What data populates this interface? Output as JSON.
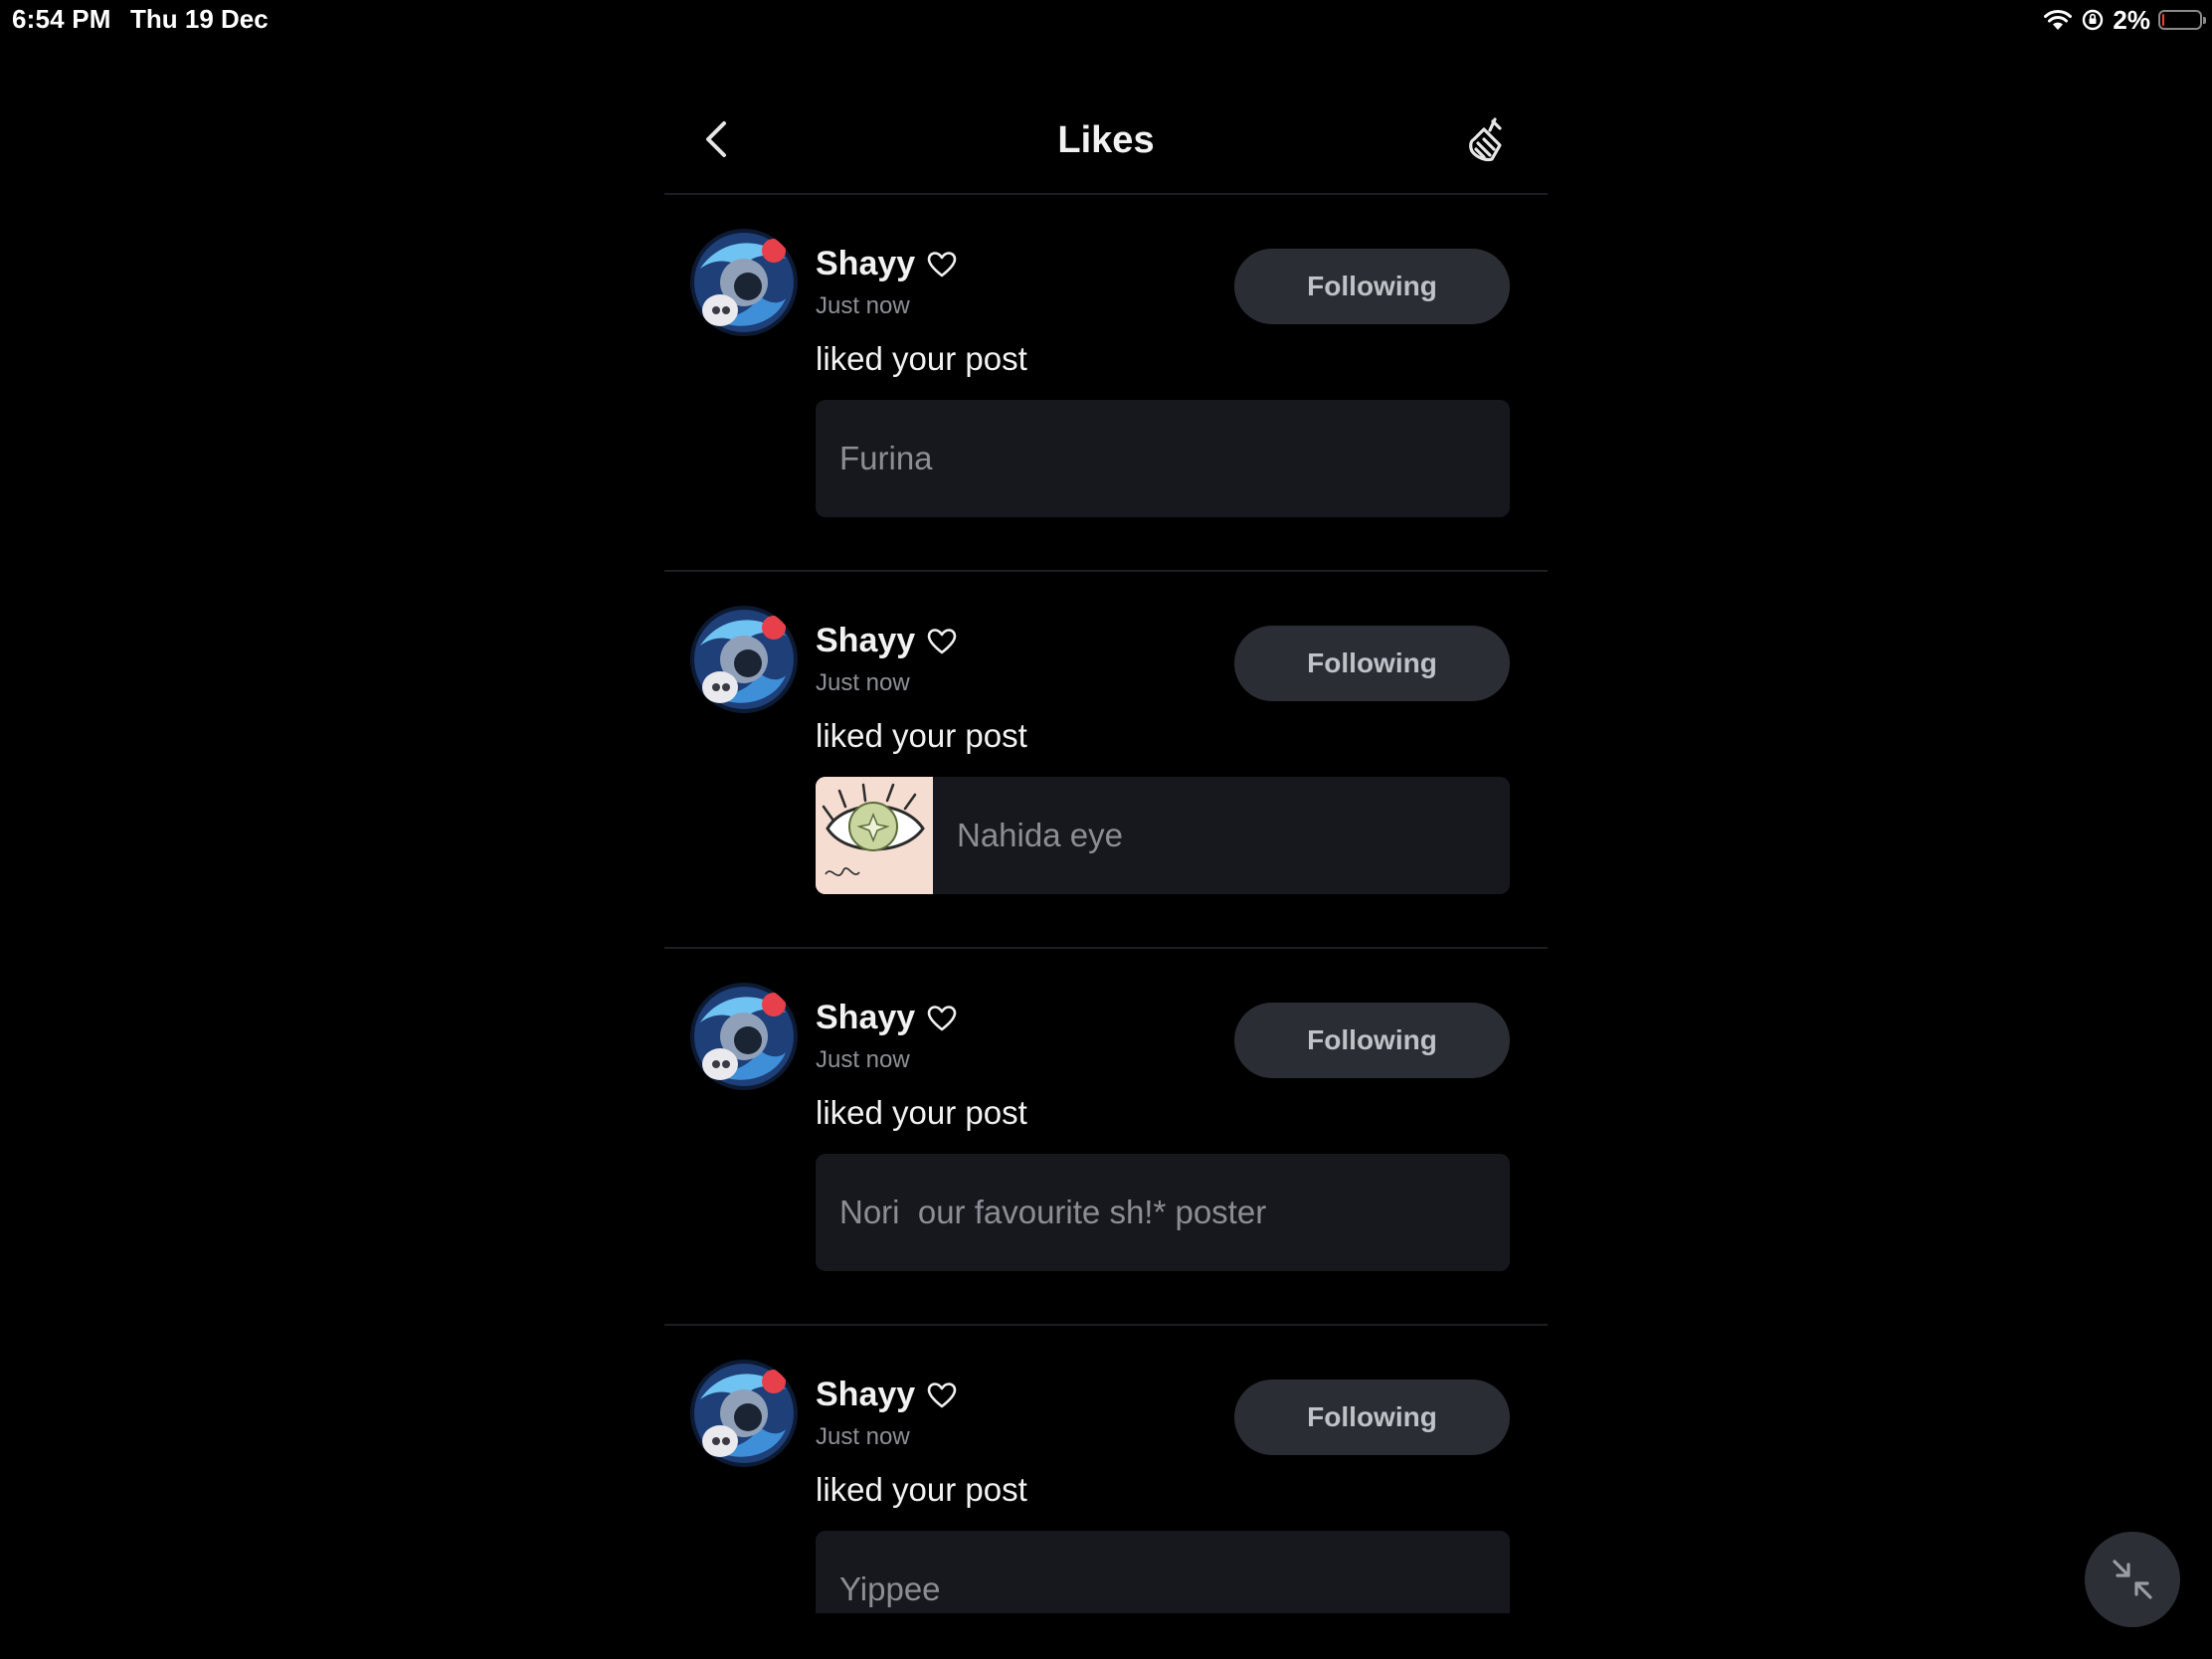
{
  "status_bar": {
    "time": "6:54 PM",
    "date": "Thu 19 Dec",
    "battery_percent": "2%",
    "battery_level": 0.02,
    "icons": [
      "wifi-icon",
      "screen-rotation-lock-icon",
      "battery-icon"
    ]
  },
  "header": {
    "title": "Likes",
    "back_icon": "chevron-left-icon",
    "clean_icon": "broom-icon"
  },
  "notifications": [
    {
      "user": "Shayy",
      "time": "Just now",
      "follow_label": "Following",
      "action": "liked your post",
      "post_title": "Furina",
      "has_thumbnail": false
    },
    {
      "user": "Shayy",
      "time": "Just now",
      "follow_label": "Following",
      "action": "liked your post",
      "post_title": "Nahida eye",
      "has_thumbnail": true
    },
    {
      "user": "Shayy",
      "time": "Just now",
      "follow_label": "Following",
      "action": "liked your post",
      "post_title": "Nori  our favourite sh!* poster",
      "has_thumbnail": false
    },
    {
      "user": "Shayy",
      "time": "Just now",
      "follow_label": "Following",
      "action": "liked your post",
      "post_title": "Yippee",
      "has_thumbnail": false
    }
  ],
  "floating_button": {
    "icon": "collapse-arrows-icon"
  },
  "colors": {
    "background": "#000000",
    "card": "#16181d",
    "button": "#2a2d33",
    "divider": "#1c1e22",
    "muted_text": "#8d9096"
  }
}
